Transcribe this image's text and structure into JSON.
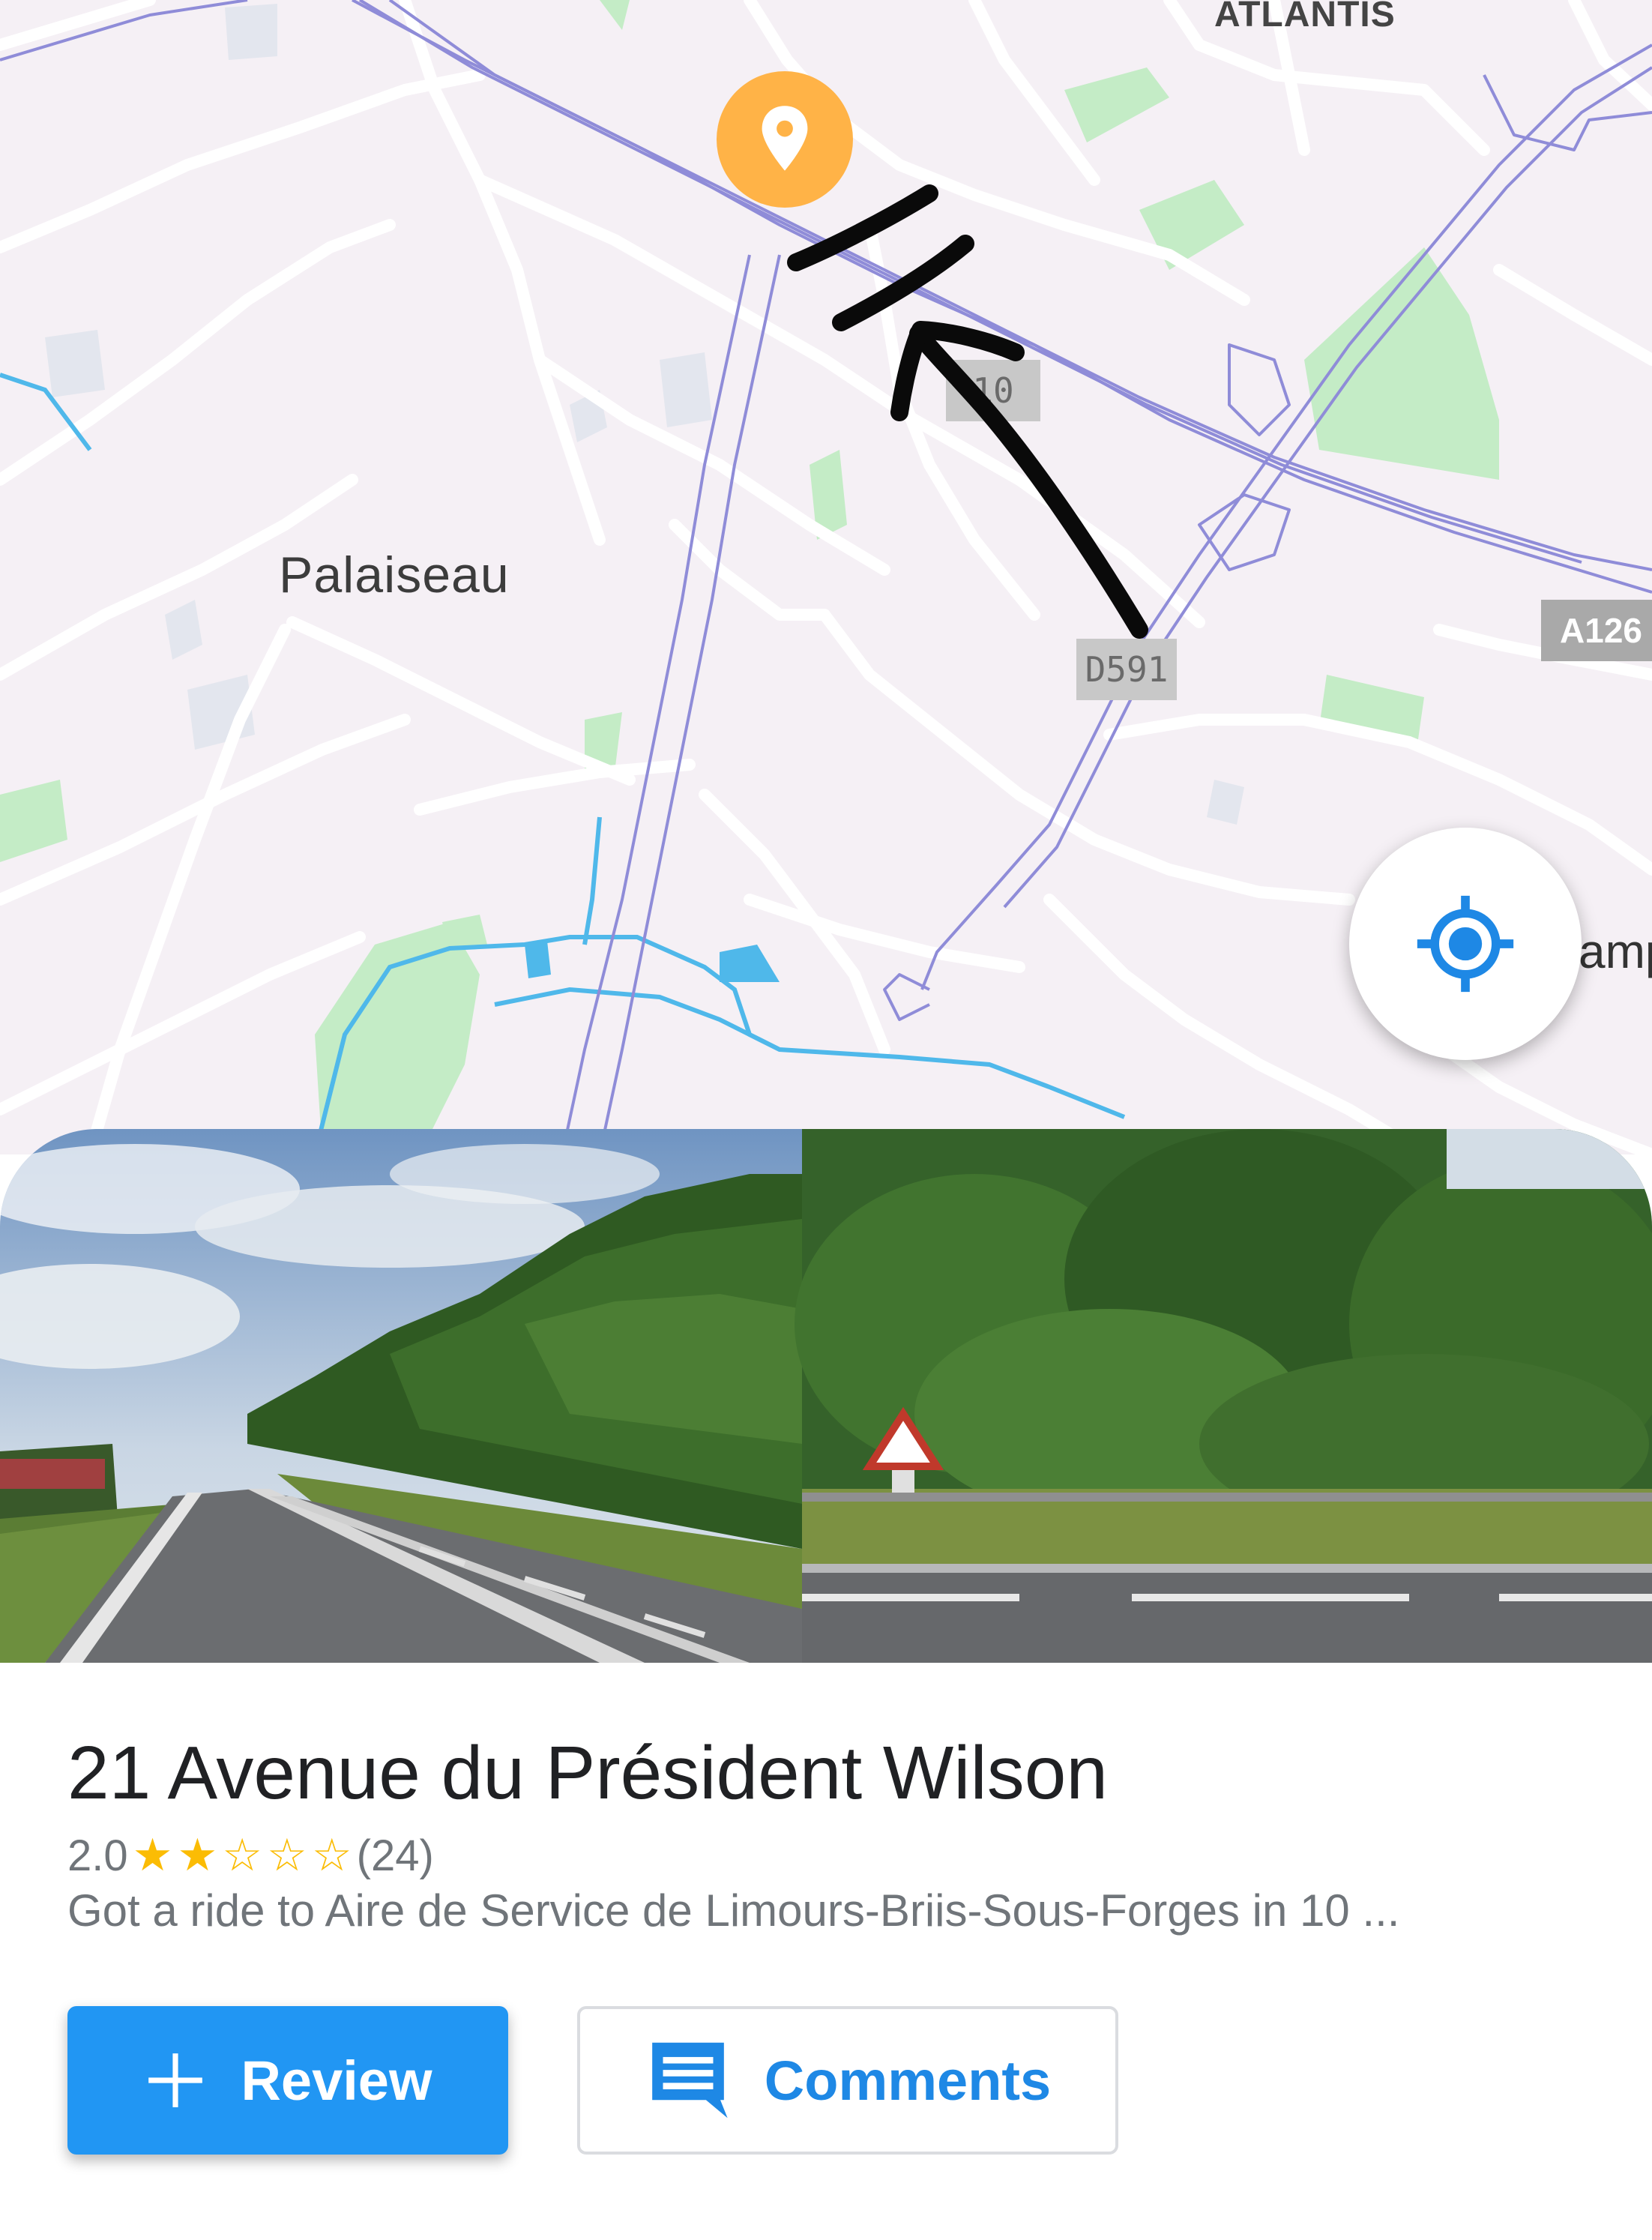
{
  "map": {
    "city_label": "Palaiseau",
    "district_label": "ATLANTIS",
    "edge_label": "amp",
    "road_shields": [
      "D591",
      "A126",
      "10"
    ],
    "pin_icon": "location-pin-icon",
    "locate_icon": "my-location-icon",
    "colors": {
      "background": "#f5f0f5",
      "roads": "#ffffff",
      "highway": "#8f8cd8",
      "water": "#4fb8ea",
      "park": "#c4ecc6",
      "pin": "#ffb347",
      "locate": "#1e88e5"
    }
  },
  "place": {
    "title": "21 Avenue du Président Wilson",
    "rating": "2.0",
    "stars_filled": 2,
    "stars_total": 5,
    "reviews_count": "(24)",
    "snippet": "Got a ride to Aire de Service de Limours-Briis-Sous-Forges in 10 ..."
  },
  "actions": {
    "review_label": "Review",
    "review_icon": "plus-icon",
    "comments_label": "Comments",
    "comments_icon": "comment-icon",
    "review_color": "#2196f3",
    "comments_color": "#1e88e5"
  }
}
